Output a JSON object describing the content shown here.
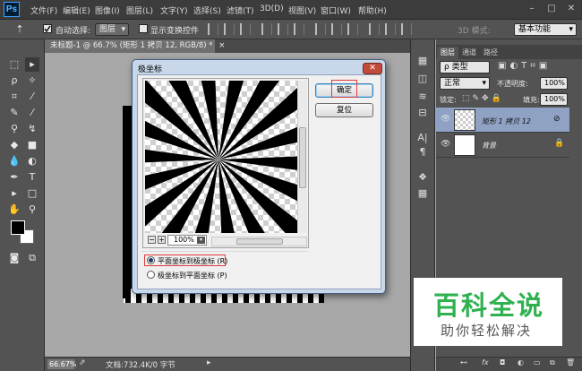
{
  "app": {
    "logo": "Ps"
  },
  "menubar": {
    "items": [
      "文件(F)",
      "编辑(E)",
      "图像(I)",
      "图层(L)",
      "文字(Y)",
      "选择(S)",
      "滤镜(T)",
      "3D(D)",
      "视图(V)",
      "窗口(W)",
      "帮助(H)"
    ],
    "window_controls": [
      "–",
      "□",
      "✕"
    ]
  },
  "options_bar": {
    "auto_select_label": "自动选择:",
    "auto_select_value": "图层",
    "show_transform_label": "显示变换控件",
    "mode_3d_label": "3D 模式:",
    "workspace_value": "基本功能"
  },
  "document": {
    "tab_label": "未标题-1 @ 66.7% (矩形 1 拷贝 12, RGB/8) *",
    "tab_close": "×"
  },
  "status_bar": {
    "zoom": "66.67%",
    "doc_info": "文档:732.4K/0 字节"
  },
  "dialog": {
    "title": "极坐标",
    "close_symbol": "✕",
    "ok_button": "确定",
    "reset_button": "复位",
    "zoom_value": "100%",
    "zoom_out": "−",
    "zoom_in": "+",
    "option_rect_to_polar": "平面坐标到极坐标 (R)",
    "option_polar_to_rect": "极坐标到平面坐标 (P)",
    "selected_option": "rect_to_polar"
  },
  "layers_panel": {
    "tabs": [
      "图层",
      "通道",
      "路径"
    ],
    "filter_label": "ρ 类型",
    "blend_mode": "正常",
    "opacity_label": "不透明度:",
    "opacity_value": "100%",
    "lock_label": "锁定:",
    "fill_label": "填充:",
    "fill_value": "100%",
    "layers": [
      {
        "name": "矩形 1 拷贝 12",
        "selected": true
      },
      {
        "name": "背景",
        "selected": false
      }
    ],
    "footer_icons": [
      "fx"
    ]
  },
  "watermark": {
    "title": "百科全说",
    "subtitle": "助你轻松解决",
    "title_color": "#2fb14f"
  }
}
